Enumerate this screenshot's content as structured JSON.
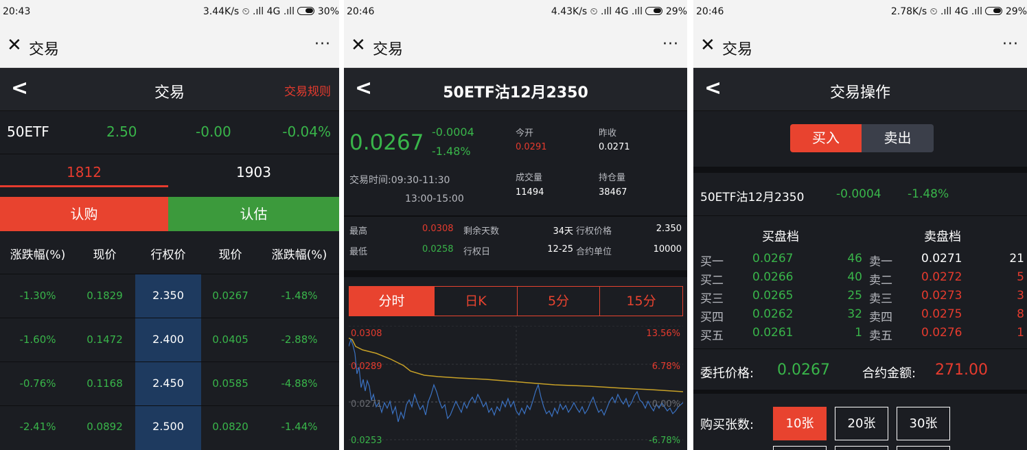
{
  "status_bars": [
    {
      "time": "20:43",
      "net": "3.44K/s",
      "signal": "4G",
      "battery": "30%"
    },
    {
      "time": "20:46",
      "net": "4.43K/s",
      "signal": "4G",
      "battery": "29%"
    },
    {
      "time": "20:46",
      "net": "2.78K/s",
      "signal": "4G",
      "battery": "29%"
    }
  ],
  "app_bar": {
    "close": "✕",
    "title": "交易",
    "more": "···"
  },
  "panel1": {
    "header": {
      "back": "<",
      "title": "交易",
      "rules": "交易规则"
    },
    "underlying": {
      "name": "50ETF",
      "price": "2.50",
      "change": "-0.00",
      "pct": "-0.04%"
    },
    "months": [
      "1812",
      "1903"
    ],
    "buttons": {
      "call": "认购",
      "put": "认估"
    },
    "columns": [
      "涨跌幅(%)",
      "现价",
      "行权价",
      "现价",
      "涨跌幅(%)"
    ],
    "rows": [
      {
        "call_pct": "-1.30%",
        "call_price": "0.1829",
        "strike": "2.350",
        "put_price": "0.0267",
        "put_pct": "-1.48%"
      },
      {
        "call_pct": "-1.60%",
        "call_price": "0.1472",
        "strike": "2.400",
        "put_price": "0.0405",
        "put_pct": "-2.88%"
      },
      {
        "call_pct": "-0.76%",
        "call_price": "0.1168",
        "strike": "2.450",
        "put_price": "0.0585",
        "put_pct": "-4.88%"
      },
      {
        "call_pct": "-2.41%",
        "call_price": "0.0892",
        "strike": "2.500",
        "put_price": "0.0820",
        "put_pct": "-1.44%"
      }
    ]
  },
  "panel2": {
    "header": {
      "back": "<",
      "title": "50ETF沽12月2350"
    },
    "price": "0.0267",
    "change": "-0.0004",
    "pct": "-1.48%",
    "open_label": "今开",
    "open": "0.0291",
    "prev_label": "昨收",
    "prev": "0.0271",
    "time_label": "交易时间:",
    "time1": "09:30-11:30",
    "time2": "13:00-15:00",
    "vol_label": "成交量",
    "vol": "11494",
    "oi_label": "持仓量",
    "oi": "38467",
    "stats": [
      {
        "l1": "最高",
        "v1": "0.0308",
        "l2": "剩余天数",
        "v2": "34天",
        "l3": "行权价格",
        "v3": "2.350"
      },
      {
        "l1": "最低",
        "v1": "0.0258",
        "l2": "行权日",
        "v2": "12-25",
        "l3": "合约单位",
        "v3": "10000"
      }
    ],
    "tabs": [
      "分时",
      "日K",
      "5分",
      "15分"
    ],
    "chart_labels": {
      "y_top": "0.0308",
      "y_mid": "0.0289",
      "y_base": "0.0271",
      "y_low": "0.0253",
      "p_top": "13.56%",
      "p_mid": "6.78%",
      "p_base": "0.00%",
      "p_low": "-6.78%"
    }
  },
  "panel3": {
    "header": {
      "back": "<",
      "title": "交易操作"
    },
    "buy": "买入",
    "sell": "卖出",
    "contract": "50ETF沽12月2350",
    "change": "-0.0004",
    "pct": "-1.48%",
    "bid_title": "买盘档",
    "ask_title": "卖盘档",
    "book": [
      {
        "bl": "买一",
        "bp": "0.0267",
        "bq": "46",
        "al": "卖一",
        "ap": "0.0271",
        "aq": "21"
      },
      {
        "bl": "买二",
        "bp": "0.0266",
        "bq": "40",
        "al": "卖二",
        "ap": "0.0272",
        "aq": "5"
      },
      {
        "bl": "买三",
        "bp": "0.0265",
        "bq": "25",
        "al": "卖三",
        "ap": "0.0273",
        "aq": "3"
      },
      {
        "bl": "买四",
        "bp": "0.0262",
        "bq": "32",
        "al": "卖四",
        "ap": "0.0275",
        "aq": "8"
      },
      {
        "bl": "买五",
        "bp": "0.0261",
        "bq": "1",
        "al": "卖五",
        "ap": "0.0276",
        "aq": "1"
      }
    ],
    "order_price_label": "委托价格:",
    "order_price": "0.0267",
    "amount_label": "合约金额:",
    "amount": "271.00",
    "qty_label": "购买张数:",
    "qty_options": [
      "10张",
      "20张",
      "30张"
    ]
  },
  "colors": {
    "red": "#e63b2e",
    "green": "#39b54a",
    "bg": "#1b1d22",
    "strike_bg": "#1e3a5f"
  }
}
